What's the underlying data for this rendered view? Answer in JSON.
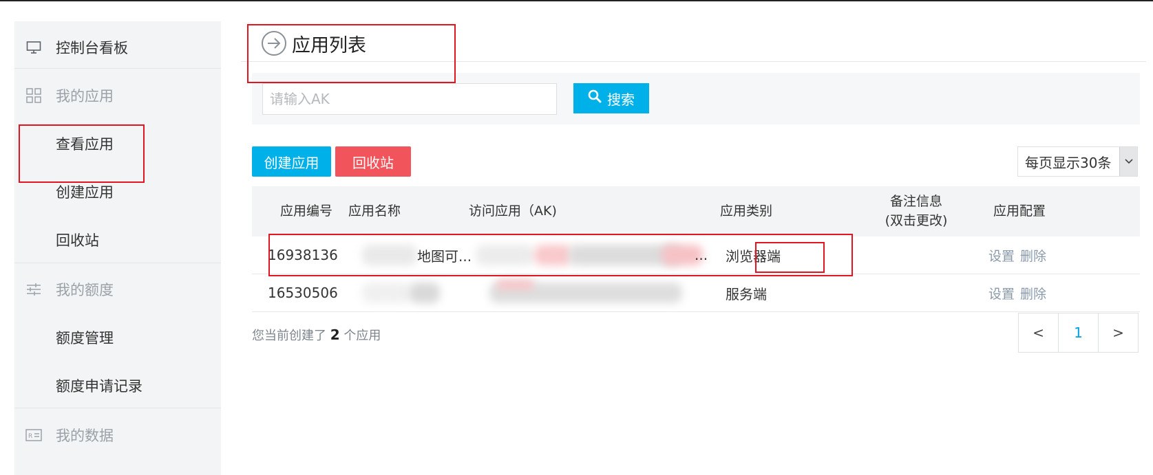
{
  "sidebar": {
    "items": [
      {
        "label": "控制台看板",
        "icon": "monitor-icon",
        "kind": "primary"
      },
      {
        "label": "我的应用",
        "icon": "apps-grid-icon",
        "kind": "section"
      },
      {
        "label": "查看应用",
        "kind": "sub"
      },
      {
        "label": "创建应用",
        "kind": "sub"
      },
      {
        "label": "回收站",
        "kind": "sub"
      },
      {
        "label": "我的额度",
        "icon": "sliders-icon",
        "kind": "section"
      },
      {
        "label": "额度管理",
        "kind": "sub"
      },
      {
        "label": "额度申请记录",
        "kind": "sub"
      },
      {
        "label": "我的数据",
        "icon": "id-card-icon",
        "kind": "section"
      }
    ]
  },
  "header": {
    "title": "应用列表",
    "icon": "arrow-circle-right-icon"
  },
  "search": {
    "placeholder": "请输入AK",
    "value": "",
    "button_label": "搜索"
  },
  "toolbar": {
    "create_label": "创建应用",
    "recycle_label": "回收站",
    "page_size_label": "每页显示30条"
  },
  "table": {
    "headers": {
      "id": "应用编号",
      "name": "应用名称",
      "ak": "访问应用（AK)",
      "type": "应用类别",
      "remark_line1": "备注信息",
      "remark_line2": "(双击更改)",
      "config": "应用配置"
    },
    "rows": [
      {
        "id": "16938136",
        "name": "地图可...",
        "ak": "...",
        "type": "浏览器端",
        "remark": "",
        "settings": "设置",
        "delete": "删除"
      },
      {
        "id": "16530506",
        "name": "",
        "ak": "",
        "type": "服务端",
        "remark": "",
        "settings": "设置",
        "delete": "删除"
      }
    ]
  },
  "footer": {
    "prefix": "您当前创建了",
    "count": "2",
    "suffix": "个应用"
  },
  "pagination": {
    "prev": "<",
    "current": "1",
    "next": ">"
  },
  "colors": {
    "accent": "#00b0e8",
    "danger": "#f2545b",
    "annotation": "#e2141f",
    "sidebar_bg": "#f2f4f5"
  }
}
